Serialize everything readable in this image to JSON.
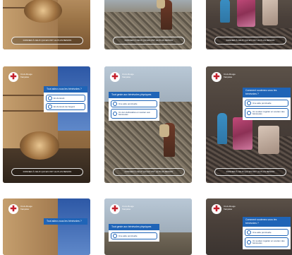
{
  "brand": {
    "name": "Croix-Rouge française",
    "logo_glyph": "✚",
    "accent": "#1f64b7",
    "brand_red": "#c41e2a"
  },
  "cards": [
    {
      "cta": "DONNER À CEUX QUI EN ONT LE PLUS BESOIN"
    },
    {
      "cta": "DONNER À CEUX QUI EN ONT LE PLUS BESOIN"
    },
    {
      "cta": "DONNER À CEUX QUI EN ONT LE PLUS BESOIN"
    },
    {
      "cta": "DONNER À CEUX QUI EN ONT LE PLUS BESOIN",
      "question": "Tout aidez-vous les bénévoles ?",
      "options": [
        "En donnant",
        "En donnant de l'argent"
      ]
    },
    {
      "cta": "DONNER À CEUX QUI EN ONT LE PLUS BESOIN",
      "question": "Tout geste aux bénévoles physiques",
      "options": [
        "Une aide ponctuelle",
        "Un don défiscalisé en soutien aux bénévoles"
      ]
    },
    {
      "cta": "DONNER À CEUX QUI EN ONT LE PLUS BESOIN",
      "question": "Comment soutenez-vous les bénévoles ?",
      "options": [
        "Une aide ponctuelle",
        "Un soutien régulier en soutien des bénévoles"
      ]
    },
    {
      "question": "Tout aidez-vous les bénévoles ?"
    },
    {
      "question": "Tout geste aux bénévoles physiques",
      "options": [
        "Une aide ponctuelle"
      ]
    },
    {
      "question": "Comment soutenez-vous les bénévoles ?",
      "options": [
        "Une aide ponctuelle",
        "Un soutien régulier en soutien des bénévoles"
      ]
    }
  ]
}
